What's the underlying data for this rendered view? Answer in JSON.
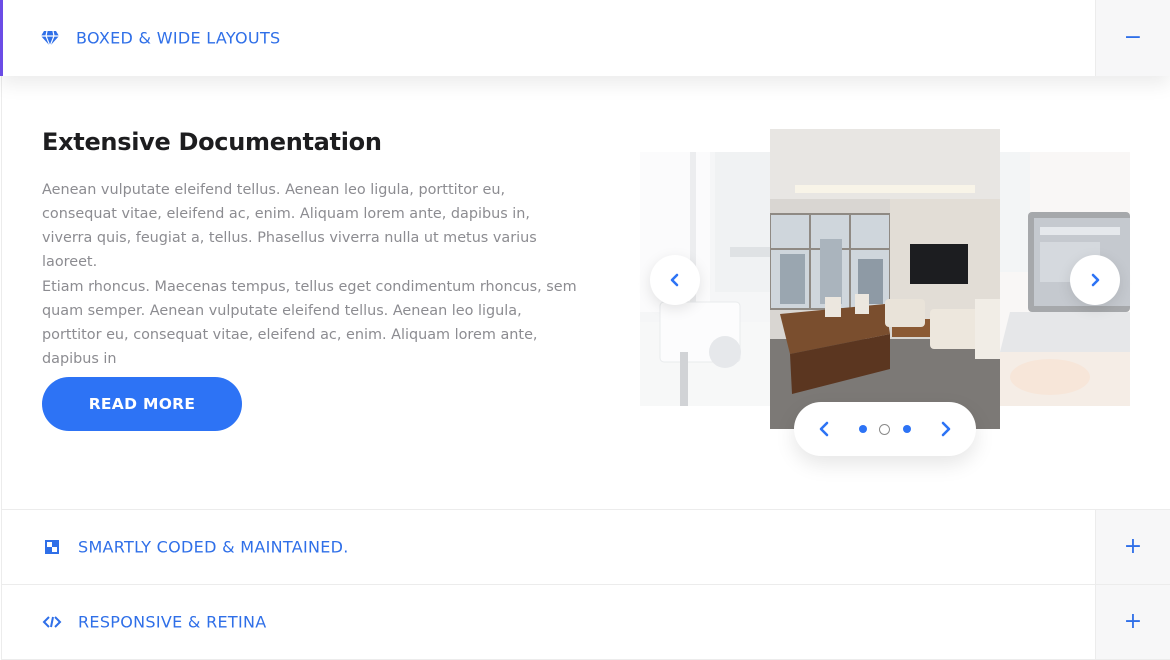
{
  "accordion": {
    "items": [
      {
        "title": "BOXED & WIDE LAYOUTS",
        "icon": "diamond-icon",
        "toggle": "−",
        "expanded": true
      },
      {
        "title": "SMARTLY CODED & MAINTAINED.",
        "icon": "checkerboard-icon",
        "toggle": "+",
        "expanded": false
      },
      {
        "title": "RESPONSIVE & RETINA",
        "icon": "code-arrows-icon",
        "toggle": "+",
        "expanded": false
      }
    ]
  },
  "content": {
    "heading": "Extensive Documentation",
    "paragraph1": "Aenean vulputate eleifend tellus. Aenean leo ligula, porttitor eu, consequat vitae, eleifend ac, enim. Aliquam lorem ante, dapibus in, viverra quis, feugiat a, tellus. Phasellus viverra nulla ut metus varius laoreet.",
    "paragraph2": "Etiam rhoncus. Maecenas tempus, tellus eget condimentum rhoncus, sem quam semper. Aenean vulputate eleifend tellus. Aenean leo ligula, porttitor eu, consequat vitae, eleifend ac, enim. Aliquam lorem ante, dapibus in",
    "button_label": "READ MORE"
  },
  "slider": {
    "slides": [
      "office-interior-image",
      "workspace-image",
      "laptop-desk-image"
    ],
    "active_index": 1,
    "pager_total": 3
  },
  "colors": {
    "accent": "#2d73f5",
    "link_blue": "#2f6fe8",
    "active_border": "#6b4ce6"
  }
}
